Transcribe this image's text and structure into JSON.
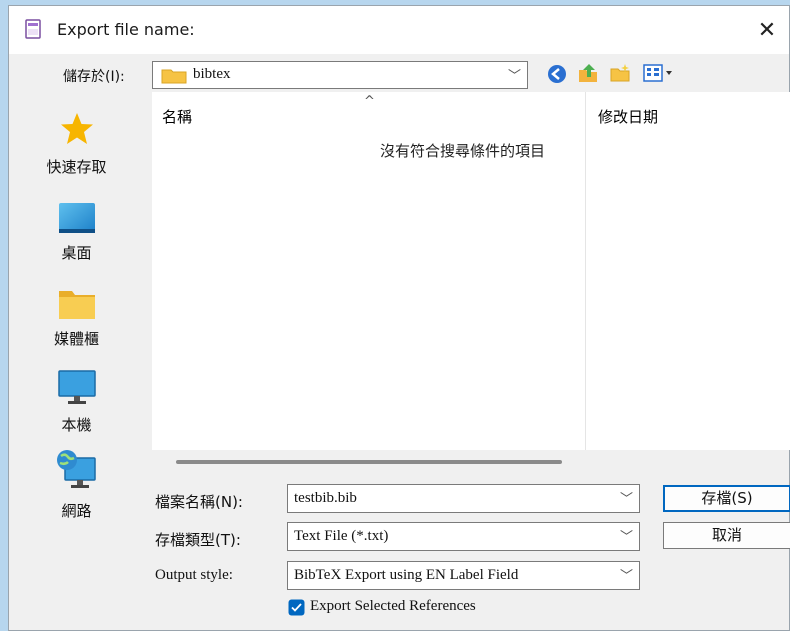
{
  "dialog": {
    "title": "Export file name:",
    "close_glyph": "✕"
  },
  "location": {
    "label": "儲存於(I):",
    "value": "bibtex",
    "toolbar_icons": [
      "back-icon",
      "up-folder-icon",
      "new-folder-icon",
      "view-menu-icon"
    ]
  },
  "sidebar": {
    "items": [
      {
        "label": "快速存取",
        "icon": "star-icon"
      },
      {
        "label": "桌面",
        "icon": "desktop-icon"
      },
      {
        "label": "媒體櫃",
        "icon": "library-folder-icon"
      },
      {
        "label": "本機",
        "icon": "computer-icon"
      },
      {
        "label": "網路",
        "icon": "network-icon"
      }
    ]
  },
  "file_list": {
    "columns": [
      "名稱",
      "修改日期"
    ],
    "empty_message": "沒有符合搜尋條件的項目"
  },
  "form": {
    "filename_label": "檔案名稱(N):",
    "filename_value": "testbib.bib",
    "filetype_label": "存檔類型(T):",
    "filetype_value": "Text File (*.txt)",
    "output_style_label": "Output style:",
    "output_style_value": "BibTeX Export using EN Label Field",
    "checkbox_label": "Export Selected References",
    "checkbox_checked": true
  },
  "buttons": {
    "save": "存檔(S)",
    "cancel": "取消"
  },
  "colors": {
    "accent": "#0067c0",
    "folder": "#f6c344",
    "background": "#f0f0f0"
  }
}
